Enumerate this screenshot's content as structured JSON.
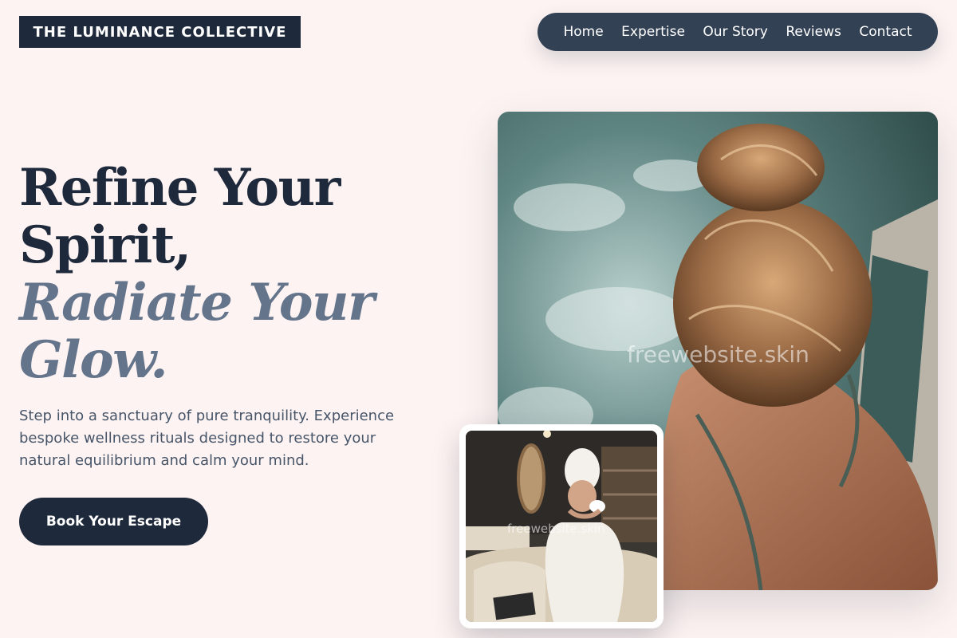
{
  "brand": {
    "name": "THE LUMINANCE COLLECTIVE"
  },
  "nav": {
    "items": [
      {
        "label": "Home"
      },
      {
        "label": "Expertise"
      },
      {
        "label": "Our Story"
      },
      {
        "label": "Reviews"
      },
      {
        "label": "Contact"
      }
    ]
  },
  "hero": {
    "headline_line1": "Refine Your",
    "headline_line2": "Spirit,",
    "headline_italic_line1": "Radiate Your",
    "headline_italic_line2": "Glow.",
    "subtext": "Step into a sanctuary of pure tranquility. Experience bespoke wellness rituals designed to restore your natural equilibrium and calm your mind.",
    "cta_label": "Book Your Escape"
  },
  "images": {
    "main_watermark": "freewebsite.skin",
    "inset_watermark": "freewebsite.skin"
  },
  "colors": {
    "background": "#fdf3f2",
    "primary_dark": "#1e293b",
    "nav_bg": "#334155",
    "accent_muted": "#64748b"
  }
}
